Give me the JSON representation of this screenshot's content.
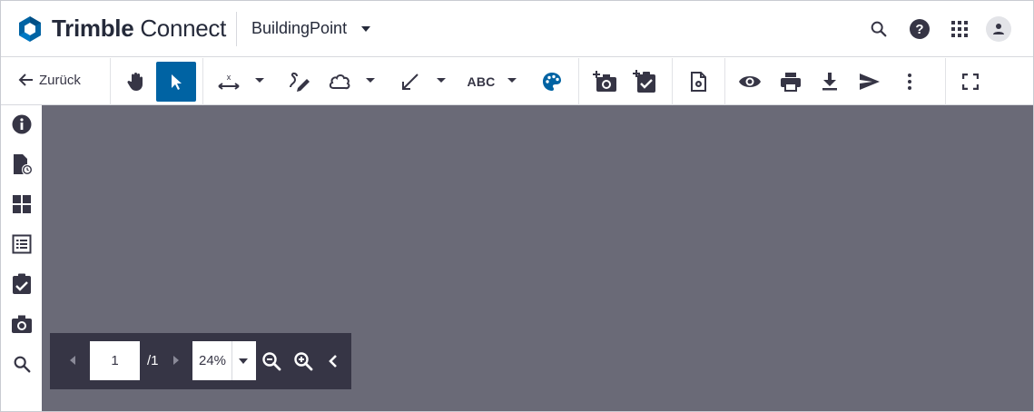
{
  "header": {
    "app_name_bold": "Trimble",
    "app_name_light": "Connect",
    "project": "BuildingPoint",
    "icons": [
      "search-icon",
      "help-icon",
      "apps-grid-icon",
      "user-avatar-icon"
    ]
  },
  "toolbar": {
    "back_label": "Zurück",
    "text_tool_label": "ABC",
    "active_tool": "select",
    "tools": [
      "pan",
      "select",
      "measure",
      "freehand-markup",
      "cloud-markup",
      "arrow-markup",
      "text-markup",
      "color",
      "add-snapshot",
      "add-todo",
      "document-settings",
      "visibility",
      "print",
      "download",
      "share",
      "more",
      "fullscreen"
    ]
  },
  "sidebar": {
    "items": [
      "info",
      "document-history",
      "views",
      "properties-list",
      "todo",
      "snapshot",
      "search"
    ]
  },
  "pager": {
    "current_page": "1",
    "total_pages": "/1",
    "zoom": "24%"
  },
  "colors": {
    "accent": "#0063a3",
    "canvas": "#6a6a77",
    "pager_bg": "#363545",
    "logo": "#0063a3"
  }
}
